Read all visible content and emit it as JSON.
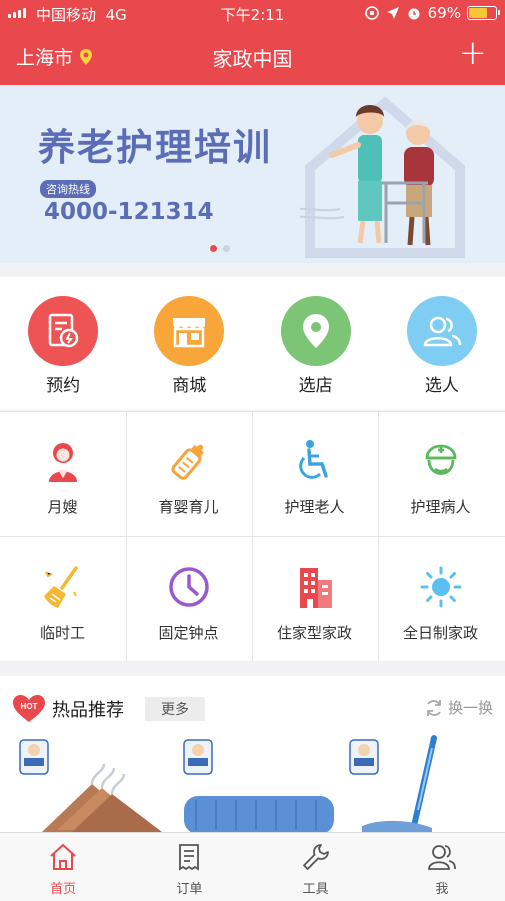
{
  "status_bar": {
    "carrier": "中国移动",
    "network": "4G",
    "time": "下午2:11",
    "battery": "69%",
    "battery_level": 0.69
  },
  "nav": {
    "city": "上海市",
    "title": "家政中国"
  },
  "banner": {
    "title": "养老护理培训",
    "hotline_label": "咨询热线",
    "phone": "4000-121314",
    "slide_count": 2,
    "active_slide": 0
  },
  "main_icons": [
    {
      "label": "预约",
      "icon": "appointment-icon",
      "color": "#ef5455"
    },
    {
      "label": "商城",
      "icon": "store-icon",
      "color": "#f8a63a"
    },
    {
      "label": "选店",
      "icon": "location-pin-icon",
      "color": "#7cc576"
    },
    {
      "label": "选人",
      "icon": "people-icon",
      "color": "#7fcdf2"
    }
  ],
  "services": [
    {
      "label": "月嫂",
      "icon": "nanny-icon",
      "color": "#e9494c"
    },
    {
      "label": "育婴育儿",
      "icon": "baby-bottle-icon",
      "color": "#f6a33a"
    },
    {
      "label": "护理老人",
      "icon": "wheelchair-icon",
      "color": "#3aa3e0"
    },
    {
      "label": "护理病人",
      "icon": "nurse-icon",
      "color": "#5cb85c"
    },
    {
      "label": "临时工",
      "icon": "broom-icon",
      "color": "#f5b830"
    },
    {
      "label": "固定钟点",
      "icon": "clock-icon",
      "color": "#9b59d0"
    },
    {
      "label": "住家型家政",
      "icon": "building-icon",
      "color": "#e9494c"
    },
    {
      "label": "全日制家政",
      "icon": "sun-icon",
      "color": "#5bc0f0"
    }
  ],
  "hot": {
    "badge": "HOT",
    "title": "热品推荐",
    "more": "更多",
    "swap": "换一换"
  },
  "tabs": [
    {
      "label": "首页",
      "icon": "home-icon",
      "active": true
    },
    {
      "label": "订单",
      "icon": "receipt-icon",
      "active": false
    },
    {
      "label": "工具",
      "icon": "wrench-icon",
      "active": false
    },
    {
      "label": "我",
      "icon": "user-icon",
      "active": false
    }
  ],
  "colors": {
    "brand": "#e9494c",
    "banner_text": "#5a6db6"
  }
}
